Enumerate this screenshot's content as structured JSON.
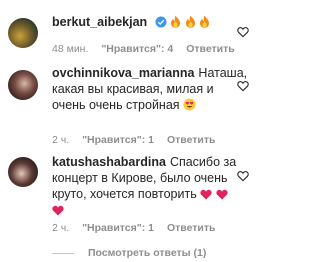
{
  "comments": [
    {
      "username": "berkut_aibekjan",
      "text": "",
      "time": "48 мин.",
      "likes": "\"Нравится\": 4",
      "reply": "Ответить"
    },
    {
      "username": "ovchinnikova_marianna",
      "text": "Наташа, какая вы красивая, милая и очень очень стройная",
      "time": "2 ч.",
      "likes": "\"Нравится\": 1",
      "reply": "Ответить"
    },
    {
      "username": "katushashabardina",
      "text": "Спасибо за концерт в Кирове, было очень круто, хочется повторить",
      "time": "2 ч.",
      "likes": "\"Нравится\": 1",
      "reply": "Ответить"
    }
  ],
  "view_replies": "Посмотреть ответы (1)",
  "icons": {
    "verified": "verified-badge-icon",
    "fire": "fire-emoji-icon",
    "heart_eyes": "heart-eyes-emoji-icon",
    "red_heart": "red-heart-emoji-icon",
    "like": "heart-outline-icon"
  },
  "colors": {
    "verified": "#3897f0",
    "meta": "#8e8e8e",
    "heart_red": "#e0245e"
  }
}
